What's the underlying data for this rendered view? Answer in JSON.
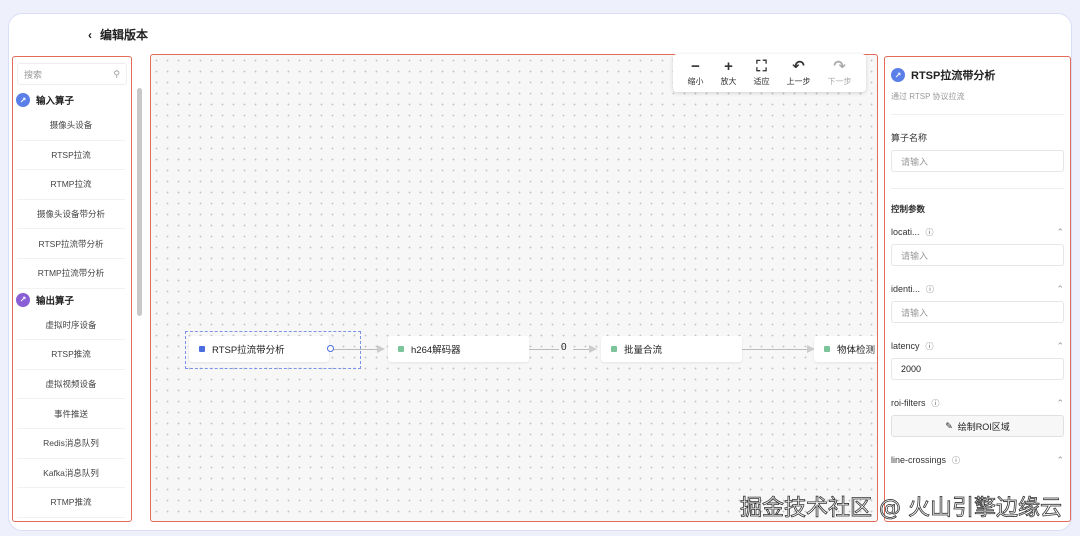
{
  "header": {
    "back_icon": "chevron-left-icon",
    "title": "编辑版本"
  },
  "sidebar": {
    "search_placeholder": "搜索",
    "groups": [
      {
        "label": "输入算子",
        "color": "#5b7fe8",
        "items": [
          "摄像头设备",
          "RTSP拉流",
          "RTMP拉流",
          "摄像头设备带分析",
          "RTSP拉流带分析",
          "RTMP拉流带分析"
        ]
      },
      {
        "label": "输出算子",
        "color": "#8a5fd6",
        "items": [
          "虚拟时序设备",
          "RTSP推流",
          "虚拟视频设备",
          "事件推送",
          "Redis消息队列",
          "Kafka消息队列",
          "RTMP推流"
        ]
      }
    ]
  },
  "toolbar": [
    {
      "label": "缩小",
      "icon": "−",
      "disabled": false
    },
    {
      "label": "放大",
      "icon": "+",
      "disabled": false
    },
    {
      "label": "适应",
      "icon": "⛶",
      "disabled": false
    },
    {
      "label": "上一步",
      "icon": "↶",
      "disabled": false
    },
    {
      "label": "下一步",
      "icon": "↷",
      "disabled": true
    }
  ],
  "canvas": {
    "nodes": [
      "RTSP拉流带分析",
      "h264解码器",
      "批量合流",
      "物体检测"
    ],
    "edge_label": "0",
    "colors": {
      "source": "#4a6ee0",
      "op": "#7cc49a"
    }
  },
  "panel": {
    "title": "RTSP拉流带分析",
    "subtitle": "通过 RTSP 协议拉流",
    "name_label": "算子名称",
    "name_placeholder": "请输入",
    "section": "控制参数",
    "params": [
      {
        "label": "locati...",
        "placeholder": "请输入"
      },
      {
        "label": "identi...",
        "placeholder": "请输入"
      },
      {
        "label": "latency",
        "value": "2000"
      },
      {
        "label": "roi-filters",
        "button": "绘制ROI区域"
      },
      {
        "label": "line-crossings"
      }
    ]
  },
  "watermark": "掘金技术社区 @ 火山引擎边缘云"
}
